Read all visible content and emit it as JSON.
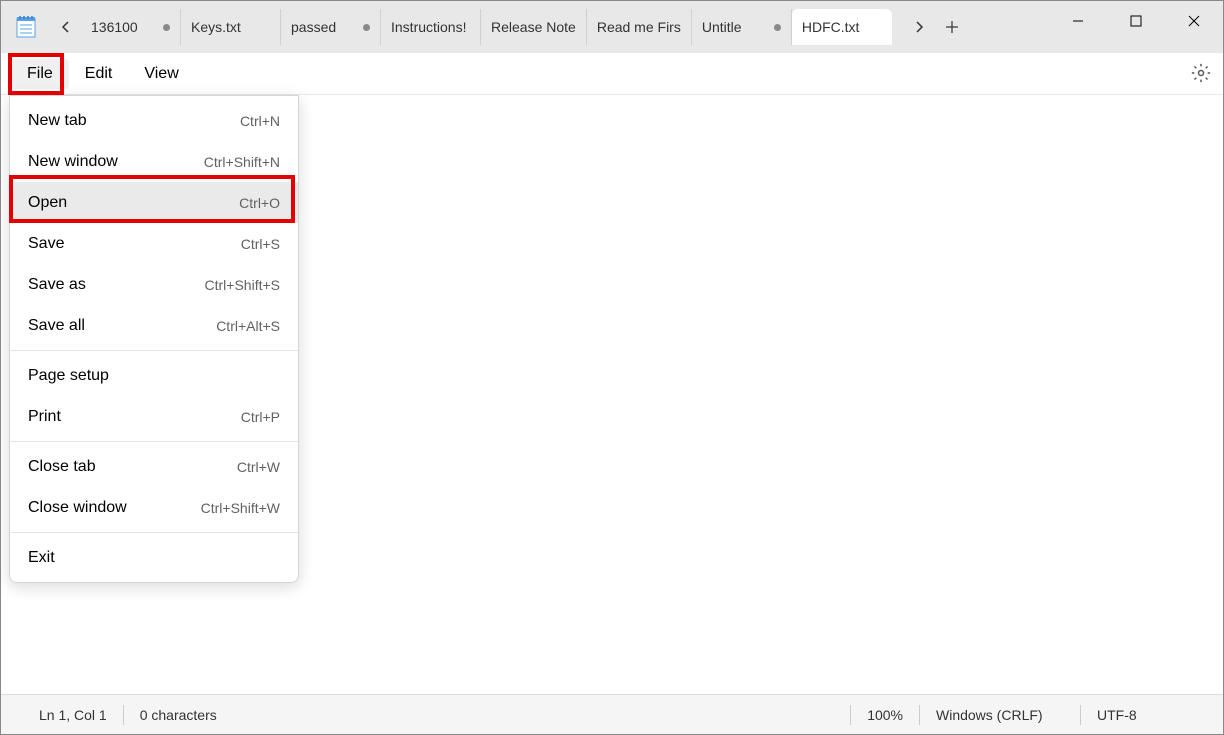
{
  "tabs": [
    {
      "label": "136100",
      "modified": true
    },
    {
      "label": "Keys.txt",
      "modified": false
    },
    {
      "label": "passed",
      "modified": true
    },
    {
      "label": "Instructions!",
      "modified": false
    },
    {
      "label": "Release Note",
      "modified": false
    },
    {
      "label": "Read me Firs",
      "modified": false
    },
    {
      "label": "Untitle",
      "modified": true
    },
    {
      "label": "HDFC.txt",
      "modified": false,
      "active": true
    }
  ],
  "menu": {
    "file": "File",
    "edit": "Edit",
    "view": "View"
  },
  "dropdown": {
    "groups": [
      [
        {
          "label": "New tab",
          "shortcut": "Ctrl+N"
        },
        {
          "label": "New window",
          "shortcut": "Ctrl+Shift+N"
        },
        {
          "label": "Open",
          "shortcut": "Ctrl+O",
          "hovered": true
        },
        {
          "label": "Save",
          "shortcut": "Ctrl+S"
        },
        {
          "label": "Save as",
          "shortcut": "Ctrl+Shift+S"
        },
        {
          "label": "Save all",
          "shortcut": "Ctrl+Alt+S"
        }
      ],
      [
        {
          "label": "Page setup",
          "shortcut": ""
        },
        {
          "label": "Print",
          "shortcut": "Ctrl+P"
        }
      ],
      [
        {
          "label": "Close tab",
          "shortcut": "Ctrl+W"
        },
        {
          "label": "Close window",
          "shortcut": "Ctrl+Shift+W"
        }
      ],
      [
        {
          "label": "Exit",
          "shortcut": ""
        }
      ]
    ]
  },
  "status": {
    "position": "Ln 1, Col 1",
    "characters": "0 characters",
    "zoom": "100%",
    "lineending": "Windows (CRLF)",
    "encoding": "UTF-8"
  }
}
